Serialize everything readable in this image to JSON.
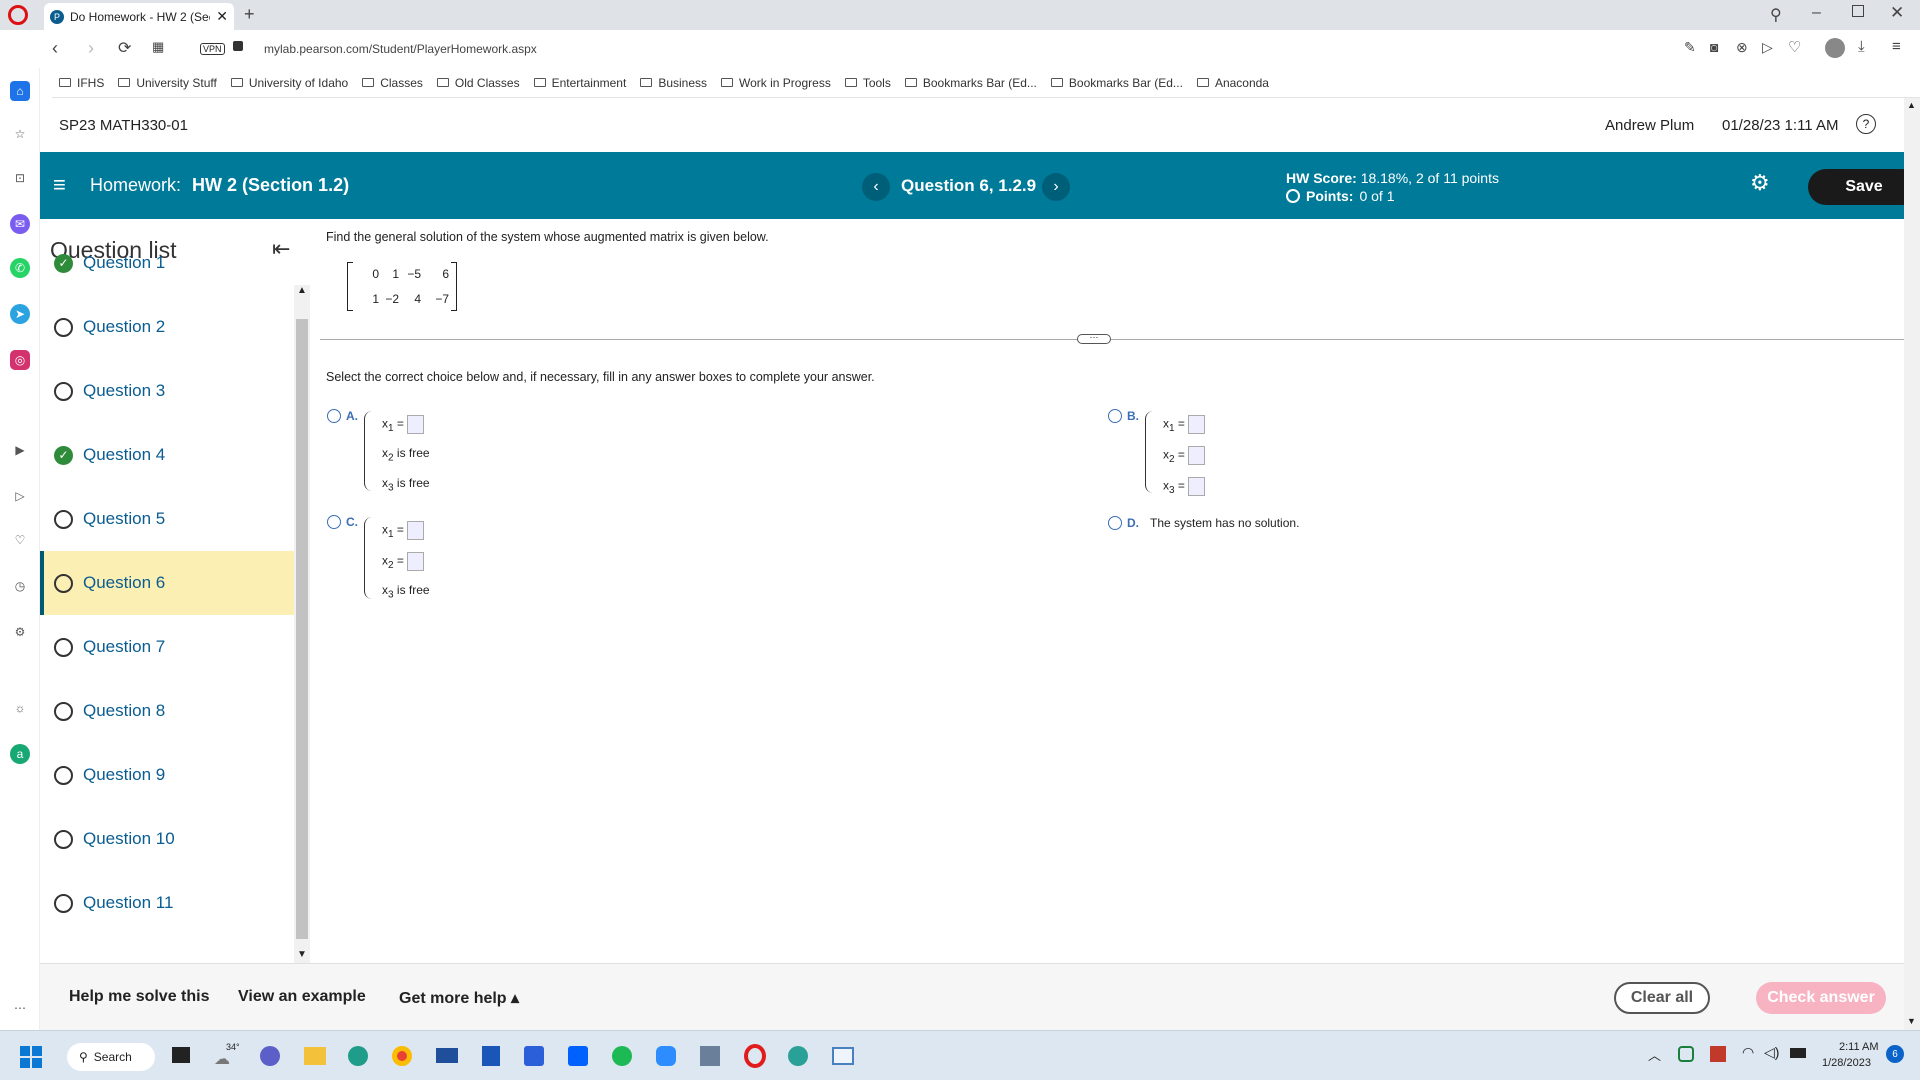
{
  "browser": {
    "tab_title": "Do Homework - HW 2 (Sec",
    "url": "mylab.pearson.com/Student/PlayerHomework.aspx",
    "vpn_label": "VPN",
    "bookmarks": [
      "IFHS",
      "University Stuff",
      "University of Idaho",
      "Classes",
      "Old Classes",
      "Entertainment",
      "Business",
      "Work in Progress",
      "Tools",
      "Bookmarks Bar (Ed...",
      "Bookmarks Bar (Ed...",
      "Anaconda"
    ]
  },
  "header": {
    "course": "SP23 MATH330-01",
    "user": "Andrew Plum",
    "datetime": "01/28/23 1:11 AM"
  },
  "bluebar": {
    "homework_label": "Homework:",
    "homework_title": "HW 2 (Section 1.2)",
    "question_label": "Question 6, 1.2.9",
    "score_label": "HW Score:",
    "score_value": "18.18%, 2 of 11 points",
    "points_label": "Points:",
    "points_value": "0 of 1",
    "save_label": "Save"
  },
  "question_list": {
    "title": "Question list",
    "items": [
      {
        "label": "Question 1",
        "status": "correct"
      },
      {
        "label": "Question 2",
        "status": "open"
      },
      {
        "label": "Question 3",
        "status": "open"
      },
      {
        "label": "Question 4",
        "status": "correct"
      },
      {
        "label": "Question 5",
        "status": "open"
      },
      {
        "label": "Question 6",
        "status": "open",
        "active": true
      },
      {
        "label": "Question 7",
        "status": "open"
      },
      {
        "label": "Question 8",
        "status": "open"
      },
      {
        "label": "Question 9",
        "status": "open"
      },
      {
        "label": "Question 10",
        "status": "open"
      },
      {
        "label": "Question 11",
        "status": "open"
      }
    ]
  },
  "problem": {
    "prompt": "Find the general solution of the system whose augmented matrix is given below.",
    "matrix": [
      [
        "0",
        "1",
        "−5",
        "6"
      ],
      [
        "1",
        "−2",
        "4",
        "−7"
      ]
    ],
    "instruction": "Select the correct choice below and, if necessary, fill in any answer boxes to complete your answer.",
    "choices": {
      "a_label": "A.",
      "b_label": "B.",
      "c_label": "C.",
      "d_label": "D.",
      "d_text": "The system has no solution.",
      "is_free": "is free"
    }
  },
  "bottom": {
    "help_solve": "Help me solve this",
    "view_example": "View an example",
    "more_help": "Get more help ▴",
    "clear_all": "Clear all",
    "check_answer": "Check answer"
  },
  "taskbar": {
    "search": "Search",
    "weather": "34°",
    "time": "2:11 AM",
    "date": "1/28/2023",
    "notifications": "6"
  }
}
